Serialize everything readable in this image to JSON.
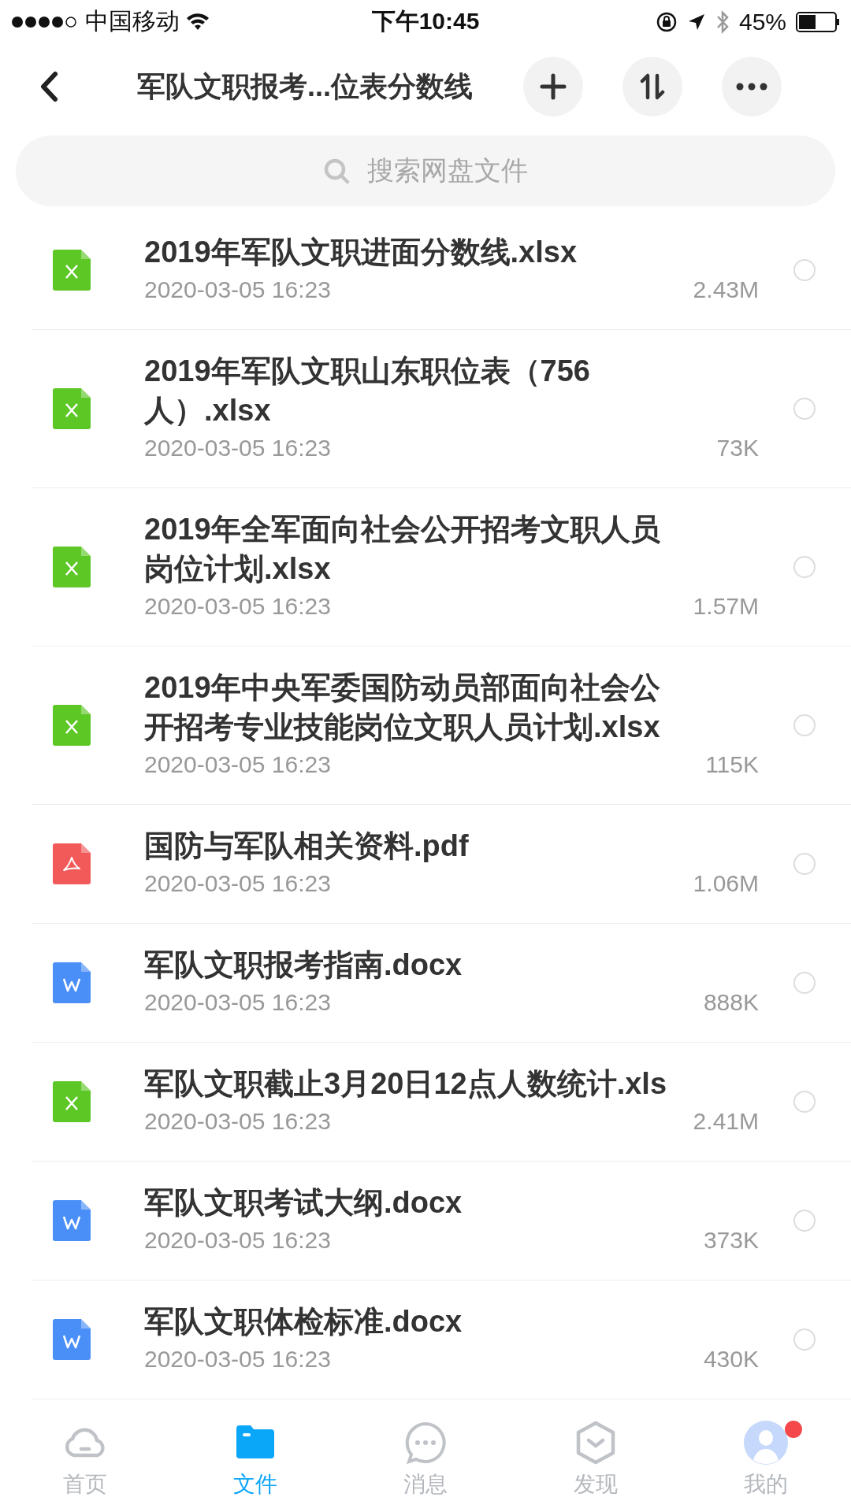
{
  "status_bar": {
    "carrier": "中国移动",
    "time": "下午10:45",
    "battery": "45%"
  },
  "header": {
    "title": "军队文职报考...位表分数线"
  },
  "search": {
    "placeholder": "搜索网盘文件"
  },
  "files": [
    {
      "kind": "sheet",
      "name": "2019年军队文职进面分数线.xlsx",
      "date": "2020-03-05 16:23",
      "size": "2.43M",
      "selected": false
    },
    {
      "kind": "sheet",
      "name": "2019年军队文职山东职位表（756人）.xlsx",
      "date": "2020-03-05 16:23",
      "size": "73K",
      "selected": false
    },
    {
      "kind": "sheet",
      "name": "2019年全军面向社会公开招考文职人员岗位计划.xlsx",
      "date": "2020-03-05 16:23",
      "size": "1.57M",
      "selected": false
    },
    {
      "kind": "sheet",
      "name": "2019年中央军委国防动员部面向社会公开招考专业技能岗位文职人员计划.xlsx",
      "date": "2020-03-05 16:23",
      "size": "115K",
      "selected": false
    },
    {
      "kind": "pdf",
      "name": "国防与军队相关资料.pdf",
      "date": "2020-03-05 16:23",
      "size": "1.06M",
      "selected": false
    },
    {
      "kind": "doc",
      "name": "军队文职报考指南.docx",
      "date": "2020-03-05 16:23",
      "size": "888K",
      "selected": false
    },
    {
      "kind": "sheet",
      "name": "军队文职截止3月20日12点人数统计.xls",
      "date": "2020-03-05 16:23",
      "size": "2.41M",
      "selected": false
    },
    {
      "kind": "doc",
      "name": "军队文职考试大纲.docx",
      "date": "2020-03-05 16:23",
      "size": "373K",
      "selected": false
    },
    {
      "kind": "doc",
      "name": "军队文职体检标准.docx",
      "date": "2020-03-05 16:23",
      "size": "430K",
      "selected": false
    }
  ],
  "tabs": [
    {
      "kind": "home",
      "label": "首页",
      "selected": false,
      "badge": false
    },
    {
      "kind": "files",
      "label": "文件",
      "selected": true,
      "badge": false
    },
    {
      "kind": "messages",
      "label": "消息",
      "selected": false,
      "badge": false
    },
    {
      "kind": "discover",
      "label": "发现",
      "selected": false,
      "badge": false
    },
    {
      "kind": "me",
      "label": "我的",
      "selected": false,
      "badge": true
    }
  ]
}
